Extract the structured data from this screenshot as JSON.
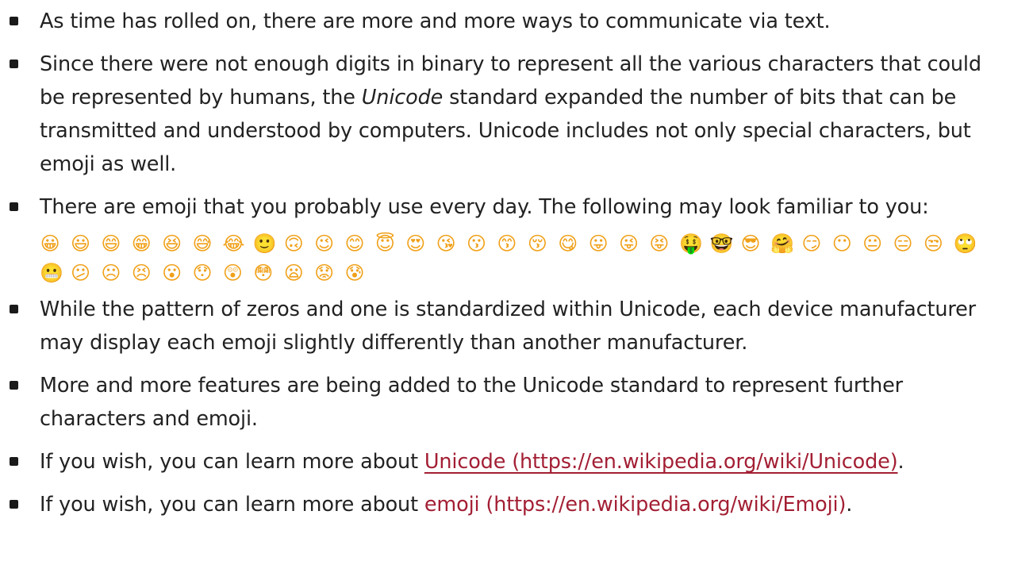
{
  "items": [
    {
      "text": "As time has rolled on, there are more and more ways to communicate via text."
    },
    {
      "pre": "Since there were not enough digits in binary to represent all the various characters that could be represented by humans, the ",
      "em": "Unicode",
      "post": " standard expanded the number of bits that can be transmitted and understood by computers. Unicode includes not only special characters, but emoji as well."
    },
    {
      "text": "There are emoji that you probably use every day. The following may look familiar to you:"
    },
    {
      "text": "While the pattern of zeros and one is standardized within Unicode, each device manufacturer may display each emoji slightly differently than another manufacturer."
    },
    {
      "text": "More and more features are being added to the Unicode standard to represent further characters and emoji."
    },
    {
      "pre": "If you wish, you can learn more about ",
      "link": "Unicode (https://en.wikipedia.org/wiki/Unicode)",
      "post": "."
    },
    {
      "pre": "If you wish, you can learn more about ",
      "link": "emoji (https://en.wikipedia.org/wiki/Emoji)",
      "post": "."
    }
  ],
  "emoji": [
    "😀",
    "😃",
    "😄",
    "😁",
    "😆",
    "😅",
    "😂",
    "🙂",
    "🙃",
    "😉",
    "😊",
    "😇",
    "😍",
    "😘",
    "😗",
    "😙",
    "😚",
    "😋",
    "😛",
    "😜",
    "😝",
    "🤑",
    "🤓",
    "😎",
    "🤗",
    "😏",
    "😶",
    "😐",
    "😑",
    "😒",
    "🙄",
    "😬",
    "😕",
    "☹",
    "😣",
    "😮",
    "😯",
    "😲",
    "😳",
    "😦",
    "😟",
    "😰"
  ],
  "colors": {
    "link": "#a31f34",
    "text": "#222222",
    "emoji_face": "#f0a018"
  }
}
